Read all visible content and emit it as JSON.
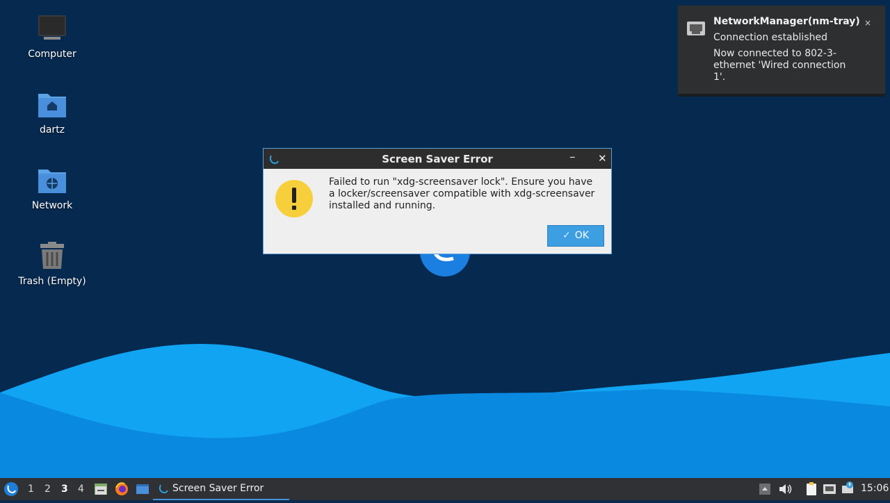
{
  "desktop": {
    "icons": [
      {
        "label": "Computer",
        "icon": "computer-icon"
      },
      {
        "label": "dartz",
        "icon": "home-folder-icon"
      },
      {
        "label": "Network",
        "icon": "network-folder-icon"
      },
      {
        "label": "Trash (Empty)",
        "icon": "trash-icon"
      }
    ]
  },
  "notification": {
    "title": "NetworkManager(nm-tray)",
    "summary": "Connection established",
    "body": "Now connected to 802-3-ethernet 'Wired connection 1'.",
    "close_label": "×",
    "icon": "network-wired-icon"
  },
  "dialog": {
    "title": "Screen Saver Error",
    "minimize_label": "–",
    "close_label": "✕",
    "message": "Failed to run  \"xdg-screensaver lock\". Ensure you have a locker/screensaver compatible with xdg-screensaver installed and running.",
    "ok_label": "OK",
    "icon": "warning-icon"
  },
  "taskbar": {
    "workspaces": [
      "1",
      "2",
      "3",
      "4"
    ],
    "active_workspace": "3",
    "task_label": "Screen Saver Error",
    "clock": "15:06"
  },
  "colors": {
    "desktop_bg": "#06294f",
    "wave_light": "#12a7f2",
    "wave_mid": "#0a88e0",
    "accent": "#3e9ee2"
  }
}
